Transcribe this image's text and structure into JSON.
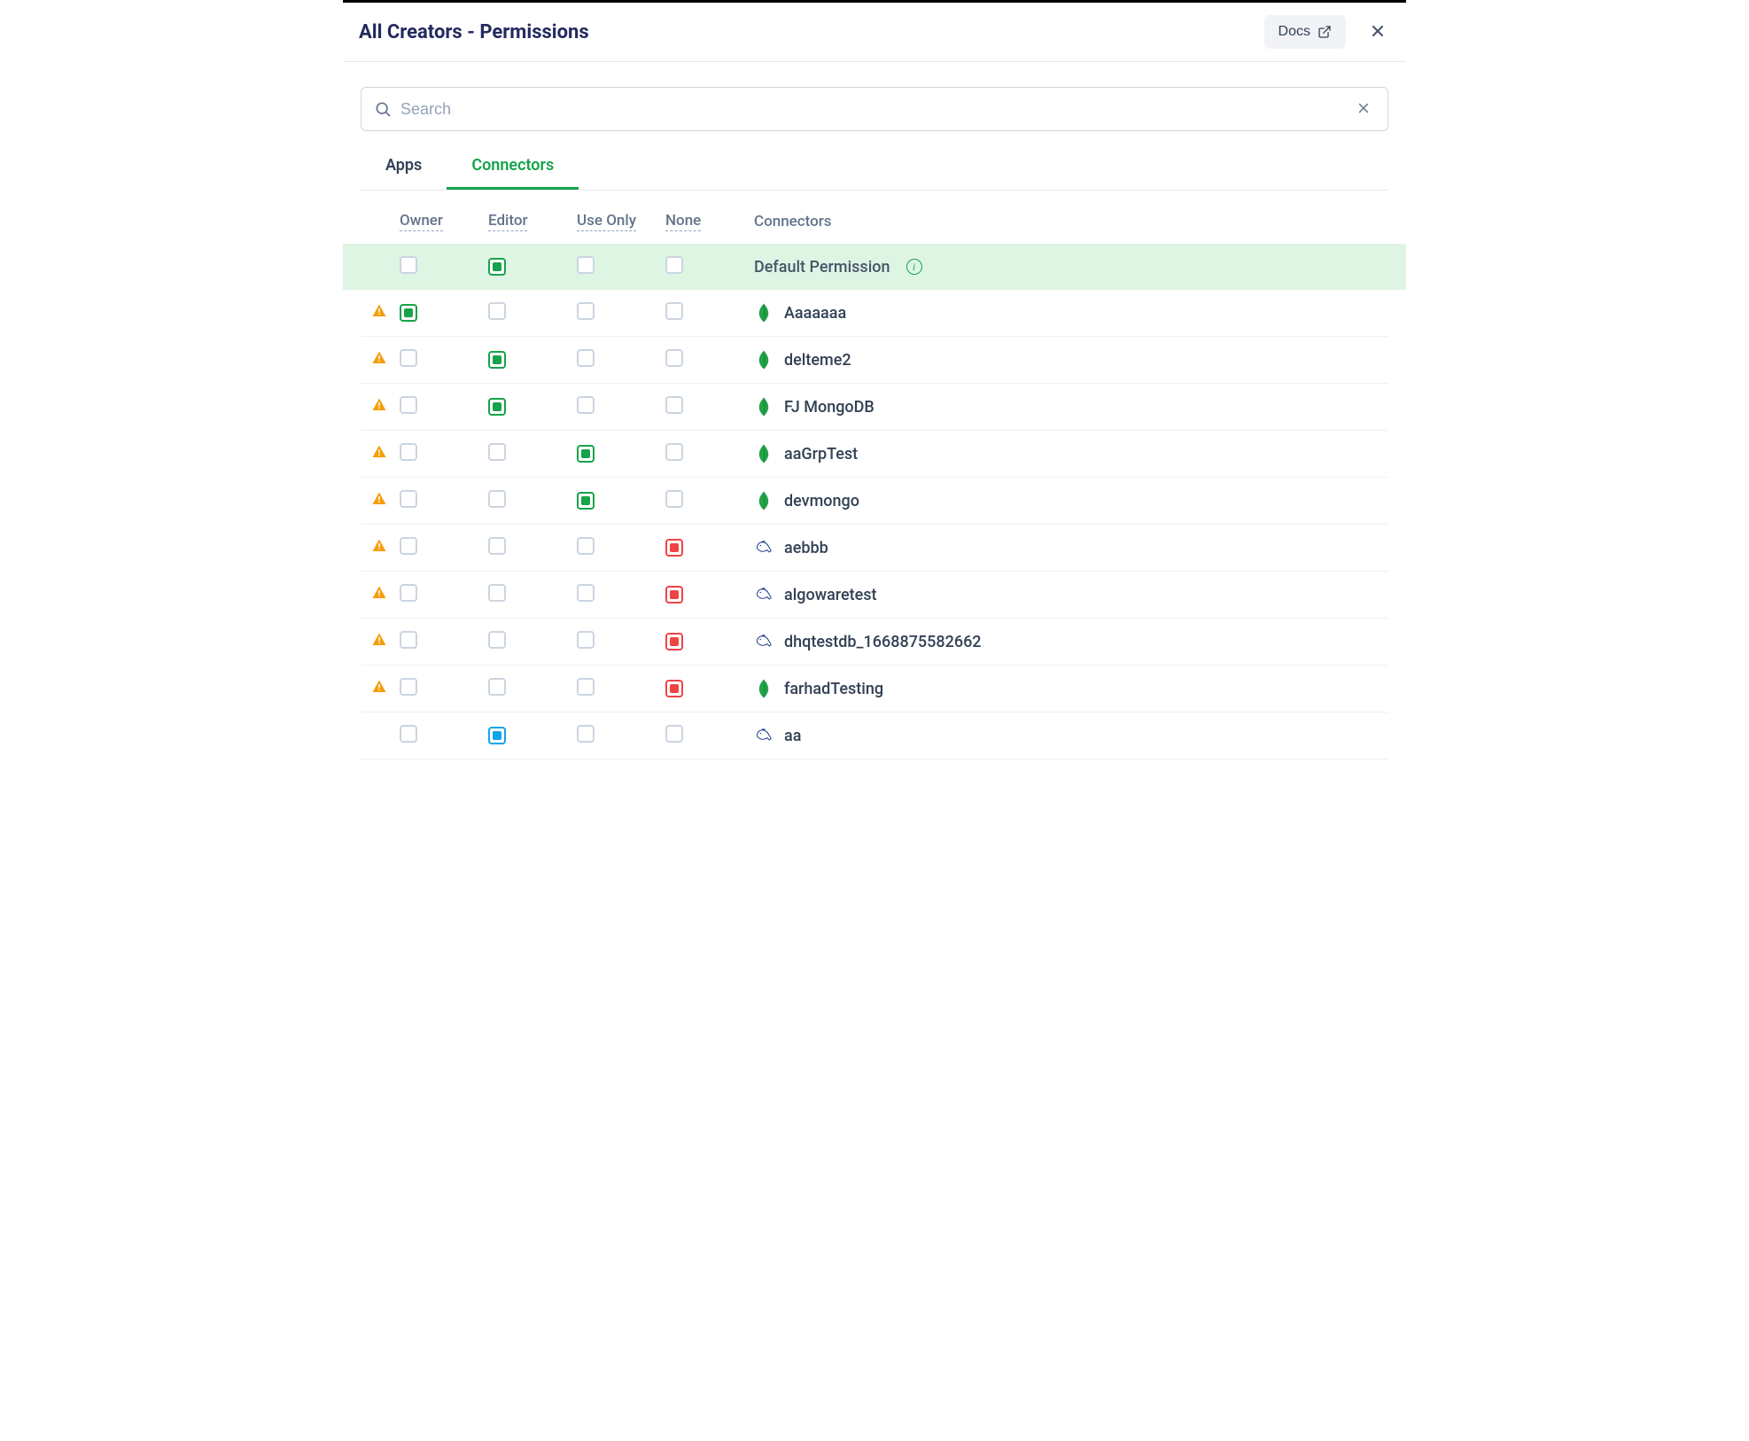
{
  "header": {
    "title": "All Creators - Permissions",
    "docs_label": "Docs"
  },
  "search": {
    "placeholder": "Search",
    "value": ""
  },
  "tabs": [
    {
      "label": "Apps",
      "active": false
    },
    {
      "label": "Connectors",
      "active": true
    }
  ],
  "columns": {
    "owner": "Owner",
    "editor": "Editor",
    "use_only": "Use Only",
    "none": "None",
    "connectors": "Connectors"
  },
  "default_row": {
    "label": "Default Permission",
    "owner": "unchecked",
    "editor": "green",
    "use_only": "unchecked",
    "none": "unchecked"
  },
  "rows": [
    {
      "warn": true,
      "icon": "mongo",
      "name": "Aaaaaaa",
      "owner": "green",
      "editor": "unchecked",
      "use_only": "unchecked",
      "none": "unchecked"
    },
    {
      "warn": true,
      "icon": "mongo",
      "name": "delteme2",
      "owner": "unchecked",
      "editor": "green",
      "use_only": "unchecked",
      "none": "unchecked"
    },
    {
      "warn": true,
      "icon": "mongo",
      "name": "FJ MongoDB",
      "owner": "unchecked",
      "editor": "green",
      "use_only": "unchecked",
      "none": "unchecked"
    },
    {
      "warn": true,
      "icon": "mongo",
      "name": "aaGrpTest",
      "owner": "unchecked",
      "editor": "unchecked",
      "use_only": "green",
      "none": "unchecked"
    },
    {
      "warn": true,
      "icon": "mongo",
      "name": "devmongo",
      "owner": "unchecked",
      "editor": "unchecked",
      "use_only": "green",
      "none": "unchecked"
    },
    {
      "warn": true,
      "icon": "mysql",
      "name": "aebbb",
      "owner": "unchecked",
      "editor": "unchecked",
      "use_only": "unchecked",
      "none": "red"
    },
    {
      "warn": true,
      "icon": "mysql",
      "name": "algowaretest",
      "owner": "unchecked",
      "editor": "unchecked",
      "use_only": "unchecked",
      "none": "red"
    },
    {
      "warn": true,
      "icon": "mysql",
      "name": "dhqtestdb_1668875582662",
      "owner": "unchecked",
      "editor": "unchecked",
      "use_only": "unchecked",
      "none": "red"
    },
    {
      "warn": true,
      "icon": "mongo",
      "name": "farhadTesting",
      "owner": "unchecked",
      "editor": "unchecked",
      "use_only": "unchecked",
      "none": "red"
    },
    {
      "warn": false,
      "icon": "mysql",
      "name": "aa",
      "owner": "unchecked",
      "editor": "blue",
      "use_only": "unchecked",
      "none": "unchecked"
    }
  ]
}
